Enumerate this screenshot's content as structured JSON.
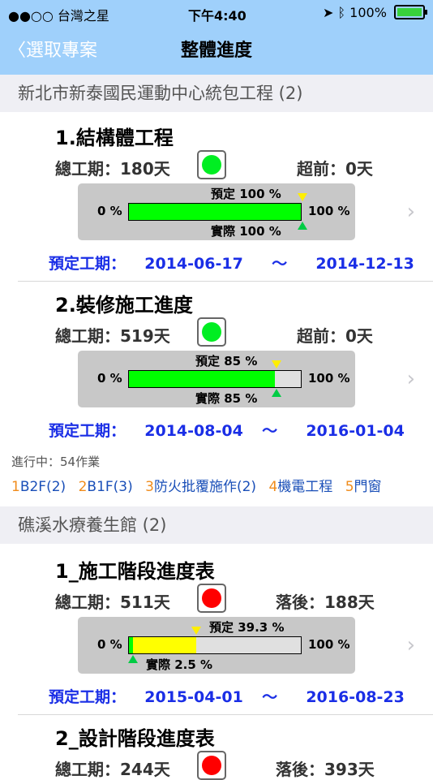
{
  "status_bar": {
    "carrier": "●●○○ 台灣之星",
    "time": "下午4:40",
    "battery": "100%"
  },
  "nav": {
    "back_label": "選取專案",
    "title": "整體進度"
  },
  "groups": [
    {
      "name": "新北市新泰國民運動中心統包工程 (2)",
      "projects": [
        {
          "title": "1.結構體工程",
          "duration": "總工期：180天",
          "status_color": "#00ee22",
          "diff": "超前：0天",
          "planned_label": "預定 100 %",
          "actual_label": "實際 100 %",
          "planned_pct": 100,
          "actual_pct": 100,
          "date_label": "預定工期：",
          "start": "2014-06-17",
          "tilde": "～",
          "end": "2014-12-13"
        },
        {
          "title": "2.裝修施工進度",
          "duration": "總工期：519天",
          "status_color": "#00ee22",
          "diff": "超前：0天",
          "planned_label": "預定 85 %",
          "actual_label": "實際 85 %",
          "planned_pct": 85,
          "actual_pct": 85,
          "date_label": "預定工期：",
          "start": "2014-08-04",
          "tilde": "～",
          "end": "2016-01-04"
        }
      ],
      "active_label": "進行中：54作業",
      "work_items": [
        {
          "num": "1",
          "label": "B2F(2)"
        },
        {
          "num": "2",
          "label": "B1F(3)"
        },
        {
          "num": "3",
          "label": "防火批覆施作(2)"
        },
        {
          "num": "4",
          "label": "機電工程"
        },
        {
          "num": "5",
          "label": "門窗"
        }
      ]
    },
    {
      "name": "礁溪水療養生館 (2)",
      "projects": [
        {
          "title": "1_施工階段進度表",
          "duration": "總工期：511天",
          "status_color": "#ff0000",
          "diff": "落後：188天",
          "planned_label": "預定 39.3 %",
          "actual_label": "實際 2.5 %",
          "planned_pct": 39.3,
          "actual_pct": 2.5,
          "date_label": "預定工期：",
          "start": "2015-04-01",
          "tilde": "～",
          "end": "2016-08-23"
        },
        {
          "title": "2_設計階段進度表",
          "duration": "總工期：244天",
          "status_color": "#ff0000",
          "diff": "落後：393天"
        }
      ]
    }
  ],
  "labels": {
    "zero": "0 %",
    "hundred": "100 %"
  }
}
